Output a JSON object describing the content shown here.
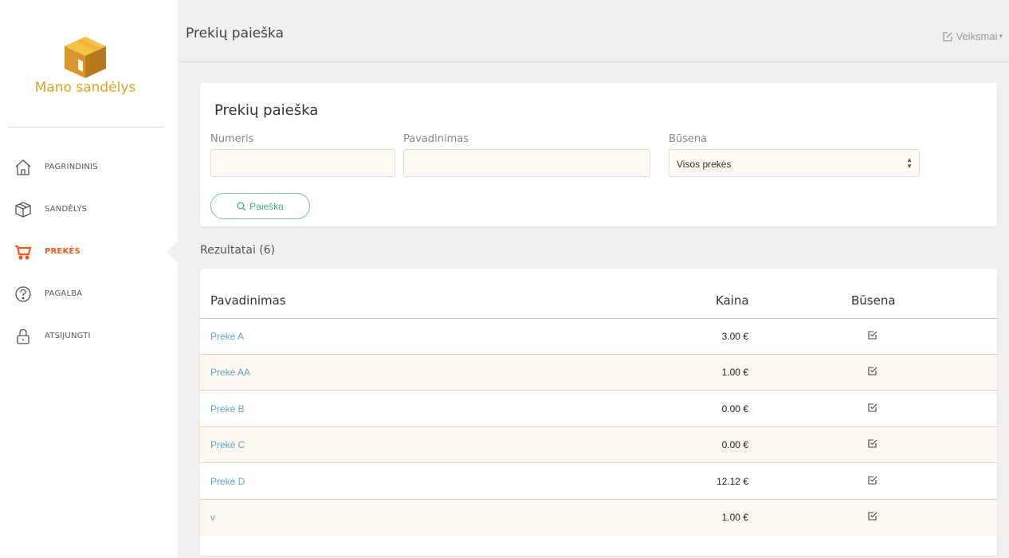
{
  "app": {
    "logo_text": "Mano sandėlys"
  },
  "sidebar": {
    "items": [
      {
        "label": "PAGRINDINIS",
        "icon": "home-icon"
      },
      {
        "label": "SANDĖLYS",
        "icon": "box-icon"
      },
      {
        "label": "PREKĖS",
        "icon": "cart-icon",
        "active": true
      },
      {
        "label": "PAGALBA",
        "icon": "help-icon"
      },
      {
        "label": "ATSIJUNGTI",
        "icon": "lock-icon"
      }
    ],
    "active_color": "#ef5a1e"
  },
  "header": {
    "title": "Prekių paieška",
    "actions_label": "Veiksmai"
  },
  "search": {
    "title": "Prekių paieška",
    "number_label": "Numeris",
    "number_value": "",
    "name_label": "Pavadinimas",
    "name_value": "",
    "status_label": "Būsena",
    "status_selected": "Visos prekės",
    "button_label": "Paieška"
  },
  "results": {
    "title": "Rezultatai (6)",
    "columns": [
      "Pavadinimas",
      "Kaina",
      "Būsena"
    ],
    "rows": [
      {
        "name": "Prekė A",
        "price": "3.00 €",
        "status": "checked"
      },
      {
        "name": "Prekė AA",
        "price": "1.00 €",
        "status": "checked"
      },
      {
        "name": "Prekė B",
        "price": "0.00 €",
        "status": "checked"
      },
      {
        "name": "Prekė C",
        "price": "0.00 €",
        "status": "checked"
      },
      {
        "name": "Prekė D",
        "price": "12.12 €",
        "status": "checked"
      },
      {
        "name": "v",
        "price": "1.00 €",
        "status": "checked"
      }
    ]
  },
  "colors": {
    "link": "#5ea6c9",
    "accent_green": "#4ab380",
    "logo_gold": "#e3a21f"
  }
}
